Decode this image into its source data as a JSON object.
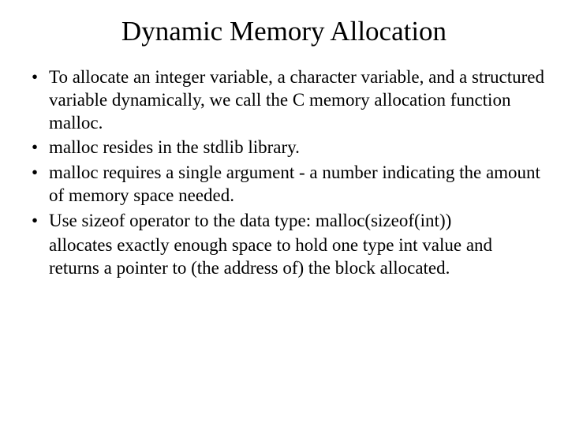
{
  "title": "Dynamic Memory Allocation",
  "bullets": {
    "b0": "To allocate an integer variable, a character variable, and a structured variable dynamically, we call the C memory allocation function malloc.",
    "b1": "malloc resides in the stdlib library.",
    "b2": "malloc requires a single argument - a number indicating the amount of memory space needed.",
    "b3": "Use sizeof operator to the data type:  malloc(sizeof(int))",
    "b3_cont": "allocates exactly enough space to hold one type int value and returns a pointer to (the address of) the block allocated."
  },
  "marker": "•"
}
